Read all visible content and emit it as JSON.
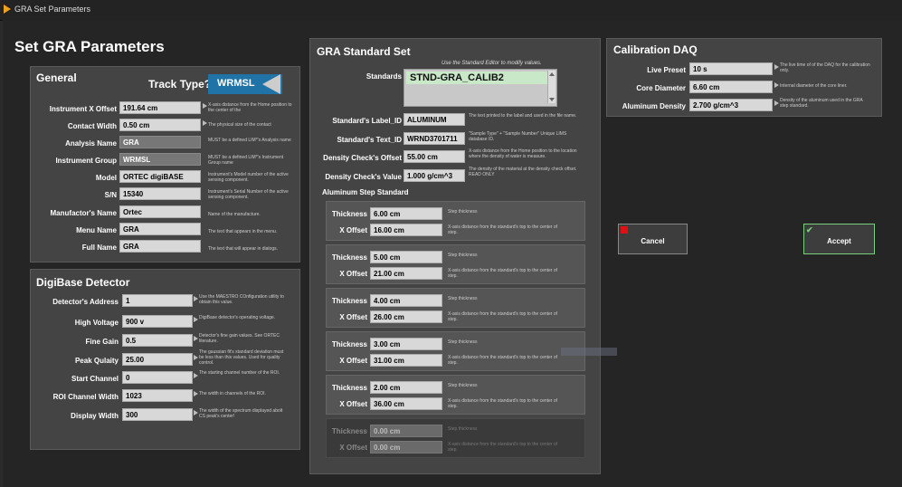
{
  "window": {
    "title": "GRA Set Parameters"
  },
  "page": {
    "title": "Set GRA Parameters"
  },
  "general": {
    "title": "General",
    "track_type_label": "Track Type?",
    "track_type_value": "WRMSL",
    "fields": [
      {
        "label": "Instrument X Offset",
        "value": "191.64 cm",
        "hint": "X-axis distance from the Home position to the center of the"
      },
      {
        "label": "Contact Width",
        "value": "0.50 cm",
        "hint": "The physical size of the contact"
      },
      {
        "label": "Analysis Name",
        "value": "GRA",
        "hint": "MUST be a defined LIM*'s Analysis name"
      },
      {
        "label": "Instrument Group",
        "value": "WRMSL",
        "hint": "MUST be a defined LIM*'s Instrument Group name"
      },
      {
        "label": "Model",
        "value": "ORTEC digiBASE",
        "hint": "Instrument's Model number of the active sensing component."
      },
      {
        "label": "S/N",
        "value": "15340",
        "hint": "Instrument's Serial Number of the active sensing component."
      },
      {
        "label": "Manufactor's Name",
        "value": "Ortec",
        "hint": "Name of the manufacture."
      },
      {
        "label": "Menu Name",
        "value": "GRA",
        "hint": "The text that appears in the menu."
      },
      {
        "label": "Full Name",
        "value": "GRA",
        "hint": "The text that will appear in dialogs."
      }
    ]
  },
  "digibase": {
    "title": "DigiBase Detector",
    "fields": [
      {
        "label": "Detector's Address",
        "value": "1",
        "hint": "Use the MAESTRO COnfiguration utility to obtain this value."
      },
      {
        "label": "High Voltage",
        "value": "900 v",
        "hint": "DigiBase detector's operating voltage."
      },
      {
        "label": "Fine Gain",
        "value": "0.5",
        "hint": "Detector's fine gain values. See ORTEC literature."
      },
      {
        "label": "Peak Qulaity",
        "value": "25.00",
        "hint": "The gaussian fit's standard deviation must be less than this values. Used for quality control."
      },
      {
        "label": "Start Channel",
        "value": "0",
        "hint": "The starting channel number of the ROI."
      },
      {
        "label": "ROI Channel Width",
        "value": "1023",
        "hint": "The width in channels of the ROI."
      },
      {
        "label": "Display Width",
        "value": "300",
        "hint": "The width of the spectrum displayed abolt CS peak's center!"
      }
    ]
  },
  "standard_set": {
    "title": "GRA Standard Set",
    "note": "Use the Standard Editor to modify values.",
    "standards_label": "Standards",
    "standards_value": "STND-GRA_CALIB2",
    "fields": [
      {
        "label": "Standard's Label_ID",
        "value": "ALUMINUM",
        "hint": "The text printed to the label and used in the file name."
      },
      {
        "label": "Standard's Text_ID",
        "value": "WRND3701711",
        "hint": "\"Sample Type\" + \"Sample Number\" Unique LIMS database ID."
      },
      {
        "label": "Density Check's Offset",
        "value": "55.00 cm",
        "hint": "X-axis distance from the Home position to the location where the density of water is measure."
      },
      {
        "label": "Density Check's Value",
        "value": "1.000 g/cm^3",
        "hint": "The density of the material at the density check offset. READ ONLY"
      }
    ],
    "aluminum_title": "Aluminum Step Standard",
    "thickness_label": "Thickness",
    "offset_label": "X Offset",
    "thickness_hint": "Step thickness",
    "offset_hint": "X-axis distance from the standard's top to the center of step.",
    "steps": [
      {
        "thickness": "6.00 cm",
        "offset": "16.00 cm"
      },
      {
        "thickness": "5.00 cm",
        "offset": "21.00 cm"
      },
      {
        "thickness": "4.00 cm",
        "offset": "26.00 cm"
      },
      {
        "thickness": "3.00 cm",
        "offset": "31.00 cm"
      },
      {
        "thickness": "2.00 cm",
        "offset": "36.00 cm"
      },
      {
        "thickness": "0.00 cm",
        "offset": "0.00 cm"
      }
    ]
  },
  "calibration": {
    "title": "Calibration DAQ",
    "fields": [
      {
        "label": "Live Preset",
        "value": "10 s",
        "hint": "The live time of of the DAQ for the calibration only."
      },
      {
        "label": "Core Diameter",
        "value": "6.60 cm",
        "hint": "Internal diameter of the core liner."
      },
      {
        "label": "Aluminum Density",
        "value": "2.700 g/cm^3",
        "hint": "Density of the aluminum used in the GRA step standard."
      }
    ]
  },
  "buttons": {
    "cancel": "Cancel",
    "accept": "Accept"
  }
}
